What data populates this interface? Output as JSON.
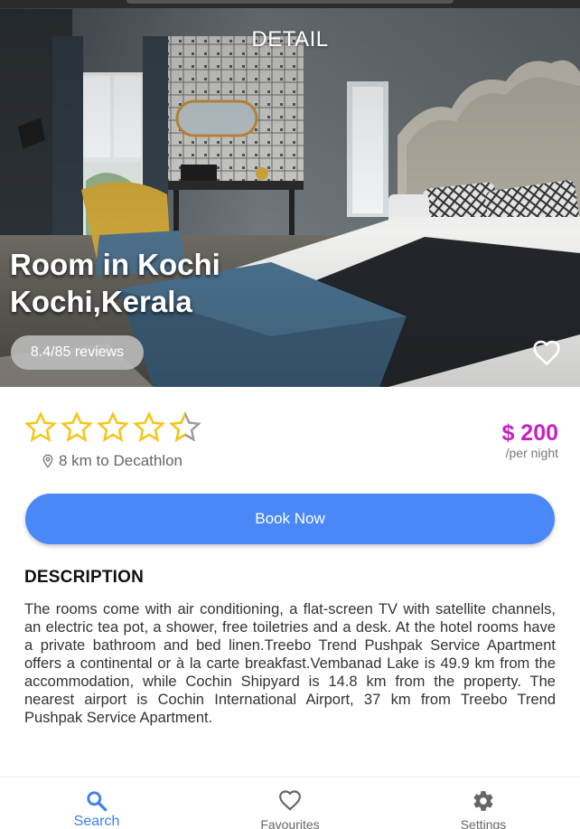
{
  "header": {
    "title": "DETAIL"
  },
  "room": {
    "name": "Room in Kochi",
    "location": "Kochi,Kerala",
    "reviews": "8.4/85 reviews",
    "rating": 4.5,
    "rating_max": 5,
    "distance": "8 km to Decathlon",
    "price": "$ 200",
    "price_unit": "/per night"
  },
  "actions": {
    "book_label": "Book Now"
  },
  "description": {
    "title": "DESCRIPTION",
    "text": "The rooms come with air conditioning, a flat-screen TV with satellite channels, an electric tea pot, a shower, free toiletries and a desk. At the hotel rooms have a private bathroom and bed linen.Treebo Trend Pushpak Service Apartment offers a continental or à la carte breakfast.Vembanad Lake is 49.9 km from the accommodation, while Cochin Shipyard is 14.8 km from the property. The nearest airport is Cochin International Airport, 37 km from Treebo Trend Pushpak Service Apartment."
  },
  "nav": {
    "items": [
      {
        "label": "Search",
        "icon": "search-icon",
        "active": true
      },
      {
        "label": "Favourites",
        "icon": "heart-icon",
        "active": false
      },
      {
        "label": "Settings",
        "icon": "gear-icon",
        "active": false
      }
    ]
  },
  "colors": {
    "accent": "#4a88f7",
    "price": "#c91fc5",
    "star": "#f5c518",
    "nav_active": "#3b7ff2"
  }
}
